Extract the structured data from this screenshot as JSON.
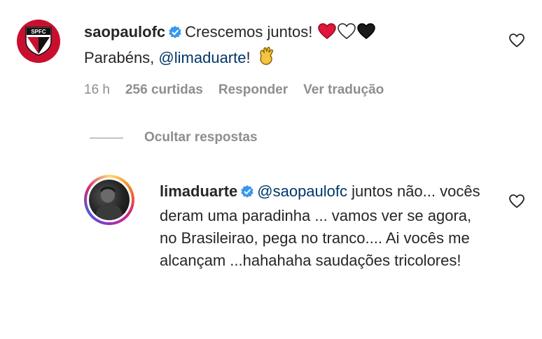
{
  "comment": {
    "username": "saopaulofc",
    "text": "Crescemos juntos!",
    "line2_prefix": "Parabéns,",
    "mention": "@limaduarte",
    "line2_suffix": "!",
    "time": "16 h",
    "likes": "256 curtidas",
    "reply_label": "Responder",
    "translate_label": "Ver tradução",
    "avatar_text": "SPFC"
  },
  "hide_replies_label": "Ocultar respostas",
  "reply": {
    "username": "limaduarte",
    "mention": "@saopaulofc",
    "text": "juntos não... vocês deram uma paradinha ... vamos ver se agora, no Brasileirao, pega no tranco.... Ai vocês me alcançam ...hahahaha saudações tricolores!"
  },
  "colors": {
    "verified": "#3897f0",
    "mention": "#00376b",
    "muted": "#8e8e8e",
    "text": "#262626",
    "spfc_red": "#c8102e"
  },
  "icons": {
    "verified": "verified-badge-icon",
    "heart_outline": "heart-outline-icon",
    "red_heart": "red-heart-emoji",
    "white_heart": "white-heart-emoji",
    "black_heart": "black-heart-emoji",
    "clap": "clapping-hands-emoji"
  }
}
